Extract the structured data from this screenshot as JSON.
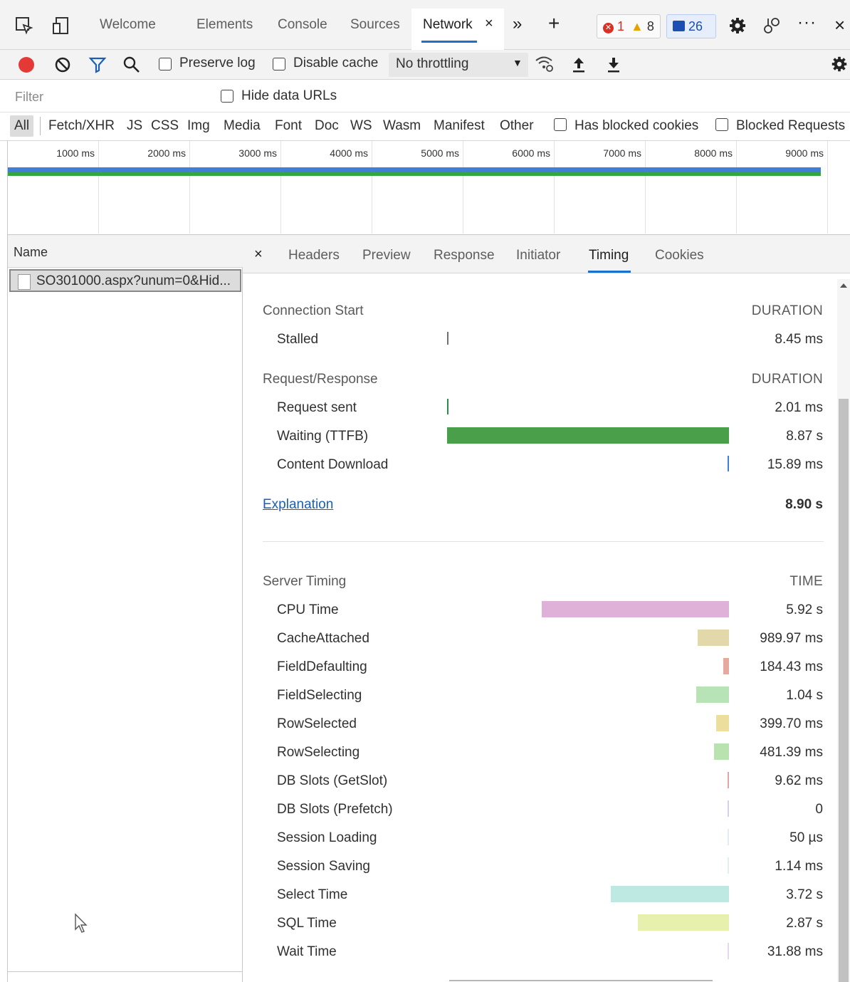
{
  "tabstrip": {
    "tabs": [
      "Welcome",
      "Elements",
      "Console",
      "Sources",
      "Network"
    ],
    "errors": "1",
    "warnings": "8",
    "messages": "26"
  },
  "toolbar": {
    "preserve_log": "Preserve log",
    "disable_cache": "Disable cache",
    "throttling": "No throttling"
  },
  "filter": {
    "placeholder": "Filter",
    "hide_data_urls": "Hide data URLs",
    "types": [
      "All",
      "Fetch/XHR",
      "JS",
      "CSS",
      "Img",
      "Media",
      "Font",
      "Doc",
      "WS",
      "Wasm",
      "Manifest",
      "Other"
    ],
    "has_blocked_cookies": "Has blocked cookies",
    "blocked_requests": "Blocked Requests"
  },
  "overview": {
    "ticks": [
      "1000 ms",
      "2000 ms",
      "3000 ms",
      "4000 ms",
      "5000 ms",
      "6000 ms",
      "7000 ms",
      "8000 ms",
      "9000 ms"
    ]
  },
  "requests": {
    "header": "Name",
    "items": [
      "SO301000.aspx?unum=0&Hid..."
    ]
  },
  "details": {
    "tabs": [
      "Headers",
      "Preview",
      "Response",
      "Initiator",
      "Timing",
      "Cookies"
    ],
    "connection_start": "Connection Start",
    "duration": "DURATION",
    "stalled_label": "Stalled",
    "stalled_value": "8.45 ms",
    "request_response": "Request/Response",
    "request_sent_label": "Request sent",
    "request_sent_value": "2.01 ms",
    "waiting_label": "Waiting (TTFB)",
    "waiting_value": "8.87 s",
    "content_download_label": "Content Download",
    "content_download_value": "15.89 ms",
    "explanation": "Explanation",
    "total": "8.90 s",
    "server_timing": "Server Timing",
    "time": "TIME",
    "server_items": [
      {
        "label": "CPU Time",
        "value": "5.92 s",
        "color": "#dfb0d8",
        "fraction": 0.665
      },
      {
        "label": "CacheAttached",
        "value": "989.97 ms",
        "color": "#e3d8a9",
        "fraction": 0.111
      },
      {
        "label": "FieldDefaulting",
        "value": "184.43 ms",
        "color": "#e5a99d",
        "fraction": 0.021
      },
      {
        "label": "FieldSelecting",
        "value": "1.04 s",
        "color": "#b7e3b7",
        "fraction": 0.117
      },
      {
        "label": "RowSelected",
        "value": "399.70 ms",
        "color": "#ecdf9e",
        "fraction": 0.045
      },
      {
        "label": "RowSelecting",
        "value": "481.39 ms",
        "color": "#b8e2b0",
        "fraction": 0.054
      },
      {
        "label": "DB Slots (GetSlot)",
        "value": "9.62 ms",
        "color": "#e0a6a6",
        "fraction": 0.003
      },
      {
        "label": "DB Slots (Prefetch)",
        "value": "0",
        "color": "#d2d2e8",
        "fraction": 0.002
      },
      {
        "label": "Session Loading",
        "value": "50 µs",
        "color": "#e2ecf1",
        "fraction": 0.002
      },
      {
        "label": "Session Saving",
        "value": "1.14 ms",
        "color": "#dff0ee",
        "fraction": 0.002
      },
      {
        "label": "Select Time",
        "value": "3.72 s",
        "color": "#bde9e2",
        "fraction": 0.418
      },
      {
        "label": "SQL Time",
        "value": "2.87 s",
        "color": "#e7f0ad",
        "fraction": 0.322
      },
      {
        "label": "Wait Time",
        "value": "31.88 ms",
        "color": "#e8d6ec",
        "fraction": 0.004
      }
    ]
  },
  "colors": {
    "accent": "#1a6fcf",
    "ttfb_bar": "#4aa04a",
    "overview_bar": "#3f7fd8",
    "overview_bar_green": "#35a53f",
    "record": "#e53935"
  }
}
